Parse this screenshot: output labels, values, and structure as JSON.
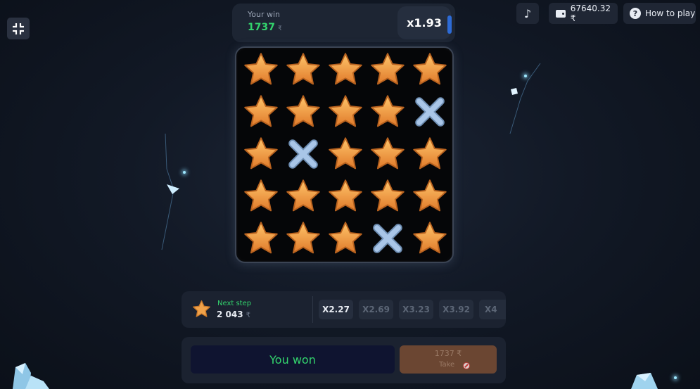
{
  "win_panel": {
    "label": "Your win",
    "amount": "1737",
    "currency": "₹",
    "multiplier": "x1.93"
  },
  "header": {
    "balance": "67640.32 ₹",
    "how_to_play": "How to play",
    "icons": [
      "collapse-icon",
      "music-note-icon",
      "wallet-icon",
      "question-icon"
    ]
  },
  "board": {
    "rows": 5,
    "cols": 5,
    "cells": [
      [
        "star",
        "star",
        "star",
        "star",
        "star"
      ],
      [
        "star",
        "star",
        "star",
        "star",
        "cross"
      ],
      [
        "star",
        "cross",
        "star",
        "star",
        "star"
      ],
      [
        "star",
        "star",
        "star",
        "star",
        "star"
      ],
      [
        "star",
        "star",
        "star",
        "cross",
        "star"
      ]
    ]
  },
  "next_step": {
    "label": "Next step",
    "amount": "2 043",
    "currency": "₹",
    "multipliers": [
      "X2.27",
      "X2.69",
      "X3.23",
      "X3.92",
      "X4"
    ]
  },
  "actions": {
    "you_won": "You won",
    "take_amount": "1737 ₹",
    "take_label": "Take"
  },
  "colors": {
    "accent_green": "#33d46d",
    "accent_blue": "#2d6bd6",
    "take_button": "#6b4632",
    "star": "#f0a24a",
    "cross": "#a9c6e8"
  }
}
